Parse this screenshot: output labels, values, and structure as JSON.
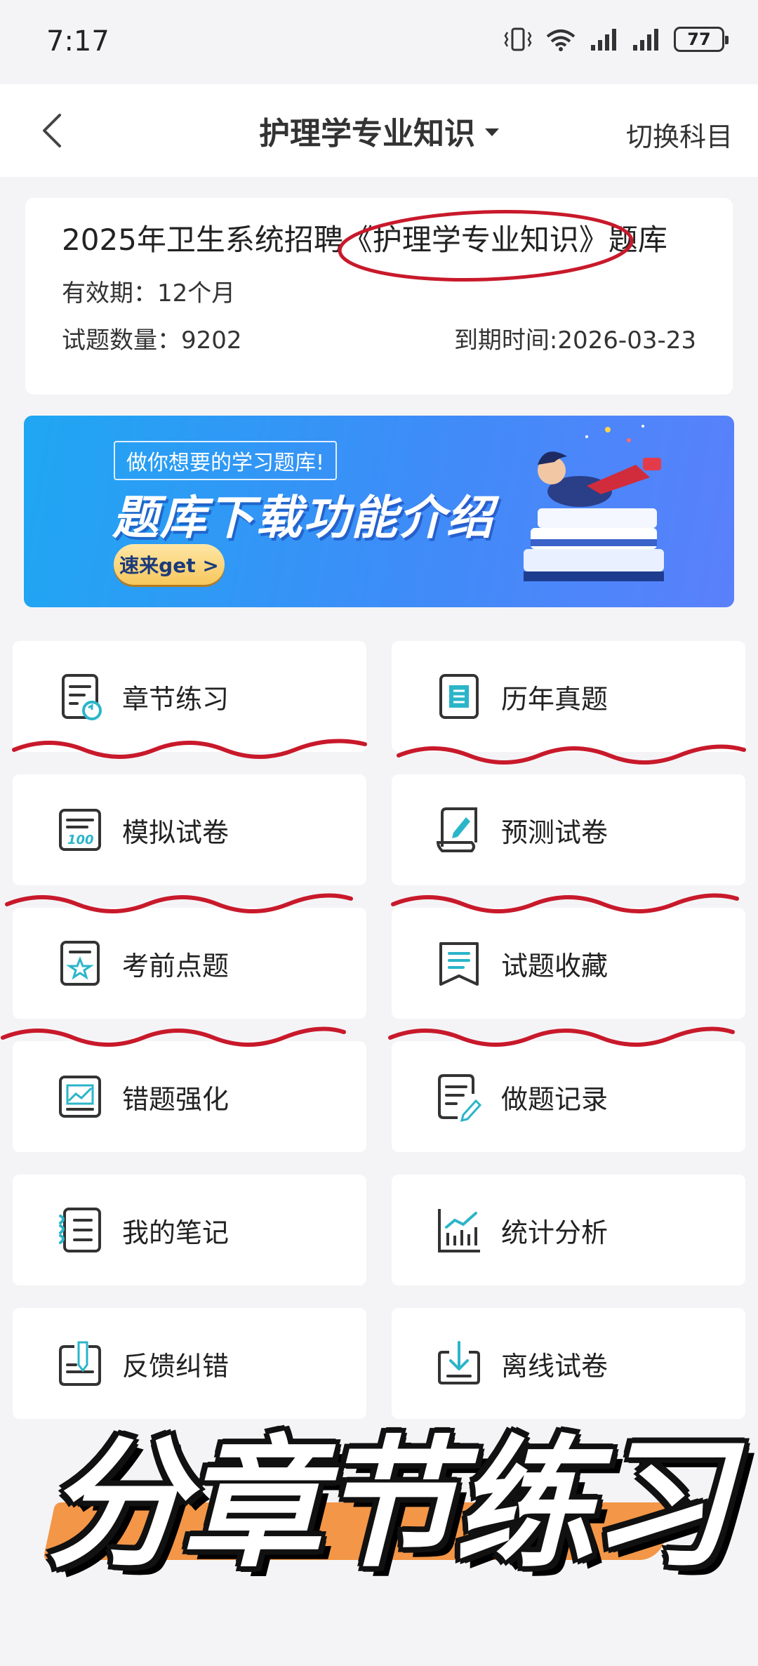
{
  "status_bar": {
    "time": "7:17",
    "battery": "77"
  },
  "header": {
    "title": "护理学专业知识",
    "switch_label": "切换科目"
  },
  "info_card": {
    "title": "2025年卫生系统招聘《护理学专业知识》题库",
    "validity_label": "有效期：",
    "validity_value": "12个月",
    "count_label": "试题数量：",
    "count_value": "9202",
    "expire_label": "到期时间:",
    "expire_value": "2026-03-23"
  },
  "banner": {
    "tag": "做你想要的学习题库!",
    "headline": "题库下载功能介绍",
    "button": "速来get >"
  },
  "menu": [
    {
      "label": "章节练习",
      "icon": "chapter-practice-icon"
    },
    {
      "label": "历年真题",
      "icon": "past-exam-icon"
    },
    {
      "label": "模拟试卷",
      "icon": "mock-exam-icon"
    },
    {
      "label": "预测试卷",
      "icon": "forecast-exam-icon"
    },
    {
      "label": "考前点题",
      "icon": "key-points-icon"
    },
    {
      "label": "试题收藏",
      "icon": "bookmark-icon"
    },
    {
      "label": "错题强化",
      "icon": "wrong-answers-icon"
    },
    {
      "label": "做题记录",
      "icon": "history-record-icon"
    },
    {
      "label": "我的笔记",
      "icon": "notes-icon"
    },
    {
      "label": "统计分析",
      "icon": "statistics-icon"
    },
    {
      "label": "反馈纠错",
      "icon": "feedback-icon"
    },
    {
      "label": "离线试卷",
      "icon": "offline-download-icon"
    }
  ],
  "caption": "分章节练习",
  "colors": {
    "accent": "#2bb5c9",
    "icon_stroke": "#333333",
    "annotation_red": "#c8192b",
    "caption_orange": "#f39647",
    "banner_blue": "#3e8cf8"
  }
}
